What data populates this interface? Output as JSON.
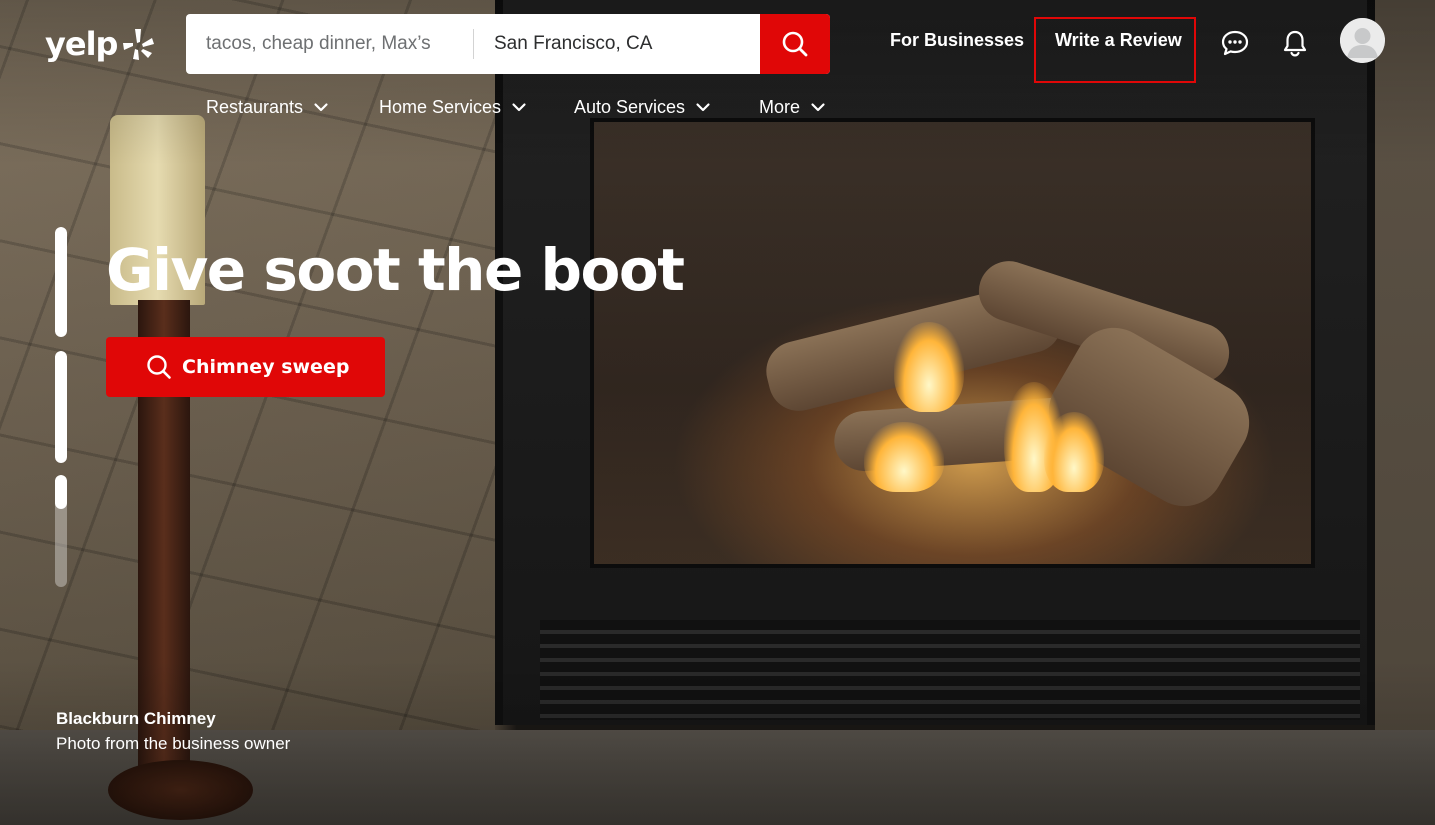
{
  "brand": {
    "name": "yelp",
    "accent": "#e00707"
  },
  "search": {
    "find_placeholder": "tacos, cheap dinner, Max’s",
    "near_value": "San Francisco, CA",
    "button_icon": "search-icon"
  },
  "header": {
    "for_businesses": "For Businesses",
    "write_review": "Write a Review",
    "messages_icon": "chat-bubble-icon",
    "notifications_icon": "bell-icon",
    "avatar_icon": "user-avatar-icon"
  },
  "categories": [
    {
      "label": "Restaurants"
    },
    {
      "label": "Home Services"
    },
    {
      "label": "Auto Services"
    },
    {
      "label": "More"
    }
  ],
  "carousel": {
    "slides": [
      {
        "progress": 1.0
      },
      {
        "progress": 1.0
      },
      {
        "progress": 0.3
      }
    ]
  },
  "hero": {
    "title": "Give soot the boot",
    "cta_label": "Chimney sweep",
    "cta_icon": "search-icon",
    "credit_name": "Blackburn Chimney",
    "credit_note": "Photo from the business owner"
  }
}
